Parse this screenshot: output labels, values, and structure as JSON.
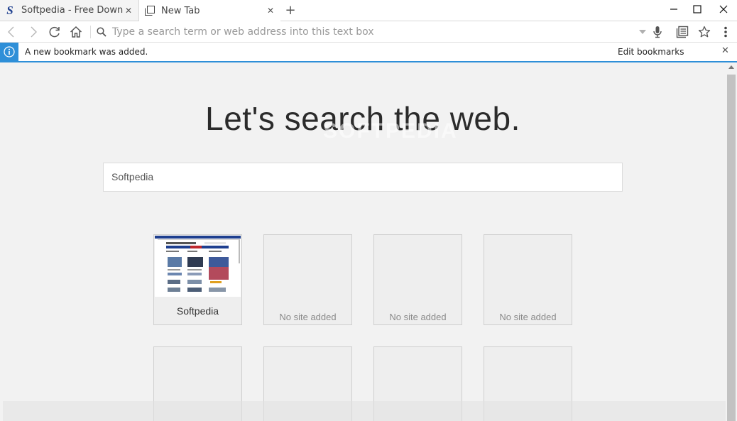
{
  "tabs": [
    {
      "title": "Softpedia - Free Downl…",
      "favicon": "softpedia-logo",
      "active": false
    },
    {
      "title": "New Tab",
      "favicon": "new-tab-icon",
      "active": true
    }
  ],
  "new_tab_symbol": "+",
  "tab_close_symbol": "✕",
  "favicon_letter": "S",
  "address_bar": {
    "placeholder": "Type a search term or web address into this text box"
  },
  "infobar": {
    "message": "A new bookmark was added.",
    "action": "Edit bookmarks",
    "close_symbol": "✕"
  },
  "main": {
    "heading": "Let's search the web.",
    "watermark": "SOFTPEDIA",
    "search_value": "Softpedia",
    "tiles": [
      {
        "label": "Softpedia",
        "thumbnail": true
      },
      {
        "label": "No site added"
      },
      {
        "label": "No site added"
      },
      {
        "label": "No site added"
      },
      {
        "label": ""
      },
      {
        "label": ""
      },
      {
        "label": ""
      },
      {
        "label": ""
      }
    ]
  },
  "colors": {
    "accent": "#2e8fd8",
    "softpedia_blue": "#1e3f8f",
    "softpedia_red": "#c0282d"
  }
}
